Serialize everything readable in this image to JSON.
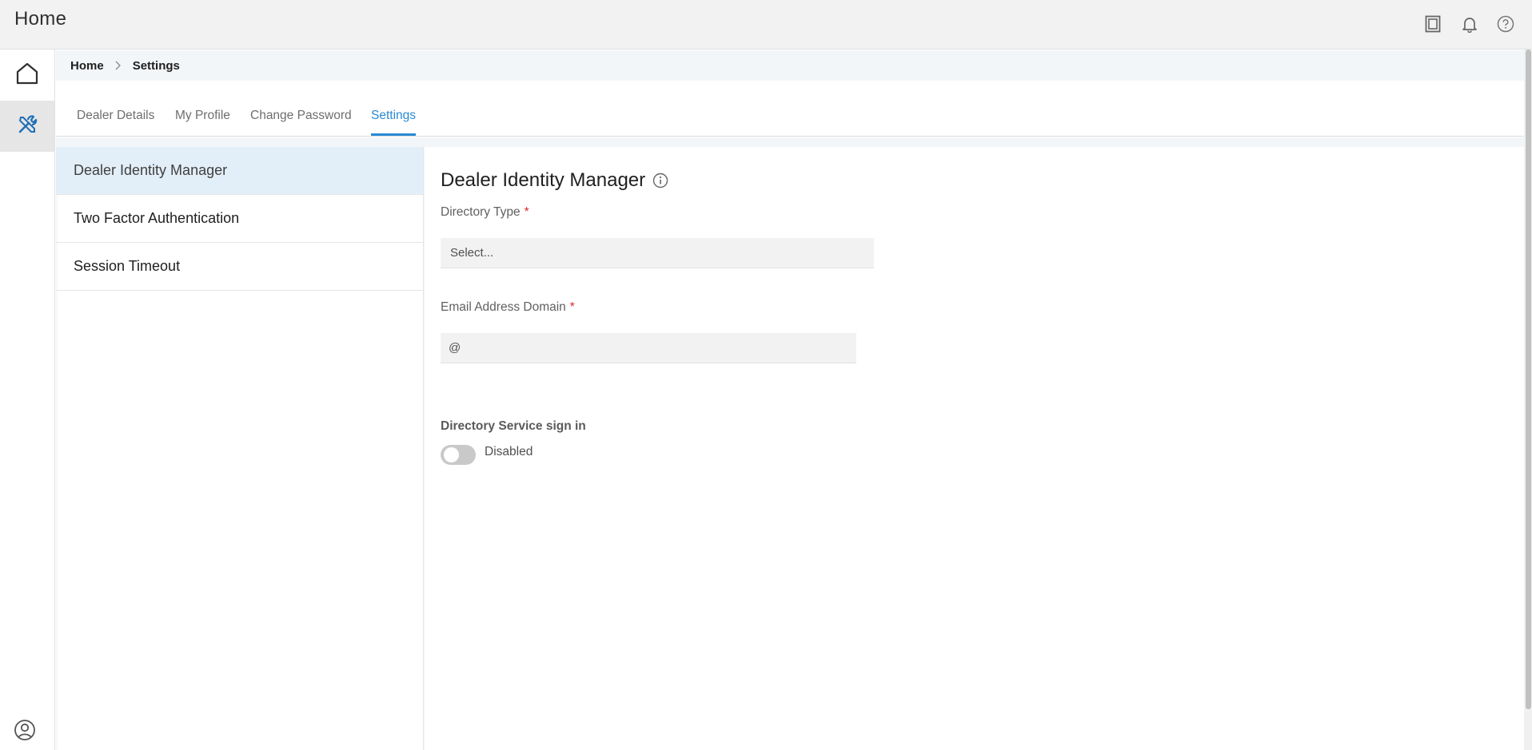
{
  "header": {
    "title": "Home",
    "icons": [
      "document-icon",
      "bell-icon",
      "help-icon"
    ]
  },
  "rail": {
    "items": [
      "home-icon",
      "tools-icon"
    ],
    "active": "tools-icon",
    "bottom_icon": "user-circle-icon"
  },
  "breadcrumb": {
    "items": [
      "Home",
      "Settings"
    ]
  },
  "tabs": {
    "items": [
      "Dealer Details",
      "My Profile",
      "Change Password",
      "Settings"
    ],
    "active": "Settings"
  },
  "settings_menu": {
    "items": [
      "Dealer Identity Manager",
      "Two Factor Authentication",
      "Session Timeout"
    ],
    "active": "Dealer Identity Manager"
  },
  "panel": {
    "title": "Dealer Identity Manager",
    "directory_type": {
      "label": "Directory Type",
      "required_mark": "*",
      "placeholder": "Select..."
    },
    "email_domain": {
      "label": "Email Address Domain",
      "required_mark": "*",
      "value": "@"
    },
    "directory_signin": {
      "label": "Directory Service sign in",
      "state": "Disabled",
      "enabled": false
    }
  },
  "colors": {
    "accent": "#2a8ad4",
    "required": "#d62c2c",
    "active_item_bg": "#e2eef8"
  }
}
